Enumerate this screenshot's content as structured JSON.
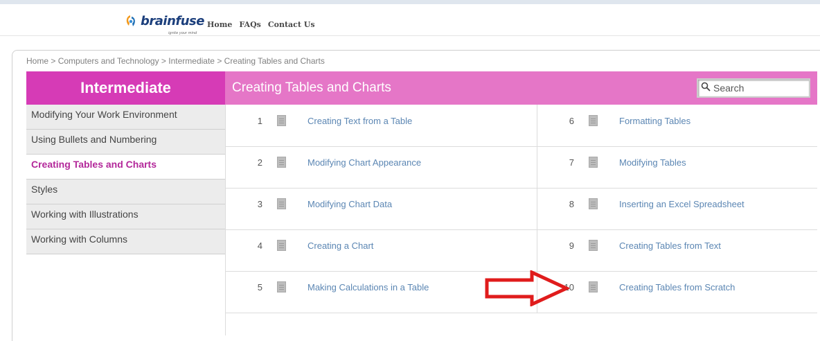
{
  "header": {
    "logo_text": "brainfuse",
    "logo_tagline": "ignite your mind",
    "nav": [
      "Home",
      "FAQs",
      "Contact Us"
    ]
  },
  "breadcrumb": {
    "items": [
      "Home",
      "Computers and Technology",
      "Intermediate",
      "Creating Tables and Charts"
    ],
    "separator": ">"
  },
  "sidebar": {
    "title": "Intermediate",
    "items": [
      {
        "label": "Modifying Your Work Environment"
      },
      {
        "label": "Using Bullets and Numbering"
      },
      {
        "label": "Creating Tables and Charts"
      },
      {
        "label": "Styles"
      },
      {
        "label": "Working with Illustrations"
      },
      {
        "label": "Working with Columns"
      }
    ],
    "active_index": 2
  },
  "content": {
    "title": "Creating Tables and Charts",
    "search_placeholder": "Search",
    "lessons": [
      {
        "num": "1",
        "title": "Creating Text from a Table"
      },
      {
        "num": "2",
        "title": "Modifying Chart Appearance"
      },
      {
        "num": "3",
        "title": "Modifying Chart Data"
      },
      {
        "num": "4",
        "title": "Creating a Chart"
      },
      {
        "num": "5",
        "title": "Making Calculations in a Table"
      },
      {
        "num": "6",
        "title": "Formatting Tables"
      },
      {
        "num": "7",
        "title": "Modifying Tables"
      },
      {
        "num": "8",
        "title": "Inserting an Excel Spreadsheet"
      },
      {
        "num": "9",
        "title": "Creating Tables from Text"
      },
      {
        "num": "10",
        "title": "Creating Tables from Scratch"
      }
    ]
  },
  "colors": {
    "sidebar_header": "#d63bb6",
    "content_header": "#e576c7",
    "active_item": "#b3289a",
    "lesson_link": "#5b86b3",
    "annotation_arrow": "#e01c1c"
  }
}
